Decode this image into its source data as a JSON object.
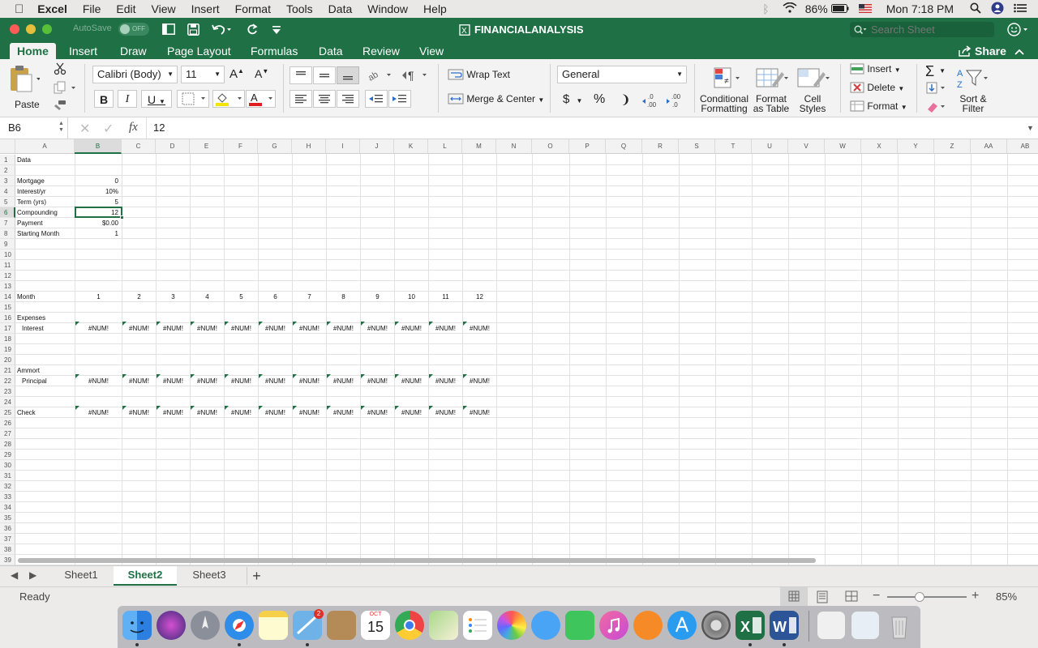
{
  "menubar": {
    "apple": "",
    "app": "Excel",
    "items": [
      "File",
      "Edit",
      "View",
      "Insert",
      "Format",
      "Tools",
      "Data",
      "Window",
      "Help"
    ],
    "battery": "86%",
    "clock": "Mon 7:18 PM"
  },
  "window": {
    "autosave": "AutoSave",
    "autosave_state": "OFF",
    "title": "FINANCIALANALYSIS",
    "search_placeholder": "Search Sheet"
  },
  "tabs": [
    "Home",
    "Insert",
    "Draw",
    "Page Layout",
    "Formulas",
    "Data",
    "Review",
    "View"
  ],
  "share": "Share",
  "ribbon": {
    "paste": "Paste",
    "font": "Calibri (Body)",
    "size": "11",
    "wrap": "Wrap Text",
    "merge": "Merge & Center",
    "numfmt": "General",
    "cond": [
      "Conditional",
      "Formatting"
    ],
    "fat": [
      "Format",
      "as Table"
    ],
    "styles": [
      "Cell",
      "Styles"
    ],
    "insert": "Insert",
    "delete": "Delete",
    "format": "Format",
    "sort": [
      "Sort &",
      "Filter"
    ],
    "bold": "B",
    "italic": "I",
    "underline": "U",
    "currency": "$",
    "percent": "%",
    "comma": "❩"
  },
  "formula": {
    "cellref": "B6",
    "value": "12",
    "fx": "fx"
  },
  "columns": [
    "A",
    "B",
    "C",
    "D",
    "E",
    "F",
    "G",
    "H",
    "I",
    "J",
    "K",
    "L",
    "M",
    "N",
    "O",
    "P",
    "Q",
    "R",
    "S",
    "T",
    "U",
    "V",
    "W",
    "X",
    "Y",
    "Z",
    "AA",
    "AB"
  ],
  "rows": [
    "1",
    "2",
    "3",
    "4",
    "5",
    "6",
    "7",
    "8",
    "9",
    "10",
    "11",
    "12",
    "13",
    "14",
    "15",
    "16",
    "17",
    "18",
    "19",
    "20",
    "21",
    "22",
    "23",
    "24",
    "25",
    "26",
    "27",
    "28",
    "29",
    "30",
    "31",
    "32",
    "33",
    "34",
    "35",
    "36",
    "37",
    "38",
    "39"
  ],
  "cells": {
    "a1": "Data",
    "a3": "Mortgage",
    "b3": "0",
    "a4": "Interest/yr",
    "b4": "10%",
    "a5": "Term (yrs)",
    "b5": "5",
    "a6": "Compounding",
    "b6": "12",
    "a7": "Payment",
    "b7": "$0.00",
    "a8": "Starting Month",
    "b8": "1",
    "a14": "Month",
    "months": [
      "1",
      "2",
      "3",
      "4",
      "5",
      "6",
      "7",
      "8",
      "9",
      "10",
      "11",
      "12"
    ],
    "a16": "Expenses",
    "a17": "Interest",
    "a21": "Ammort",
    "a22": "Principal",
    "a25": "Check",
    "err": "#NUM!"
  },
  "sheets": [
    "Sheet1",
    "Sheet2",
    "Sheet3"
  ],
  "add_sheet": "+",
  "status": "Ready",
  "zoom": "85%",
  "dock": {
    "calendar_month": "OCT",
    "calendar_day": "15",
    "mail_badge": "2"
  }
}
